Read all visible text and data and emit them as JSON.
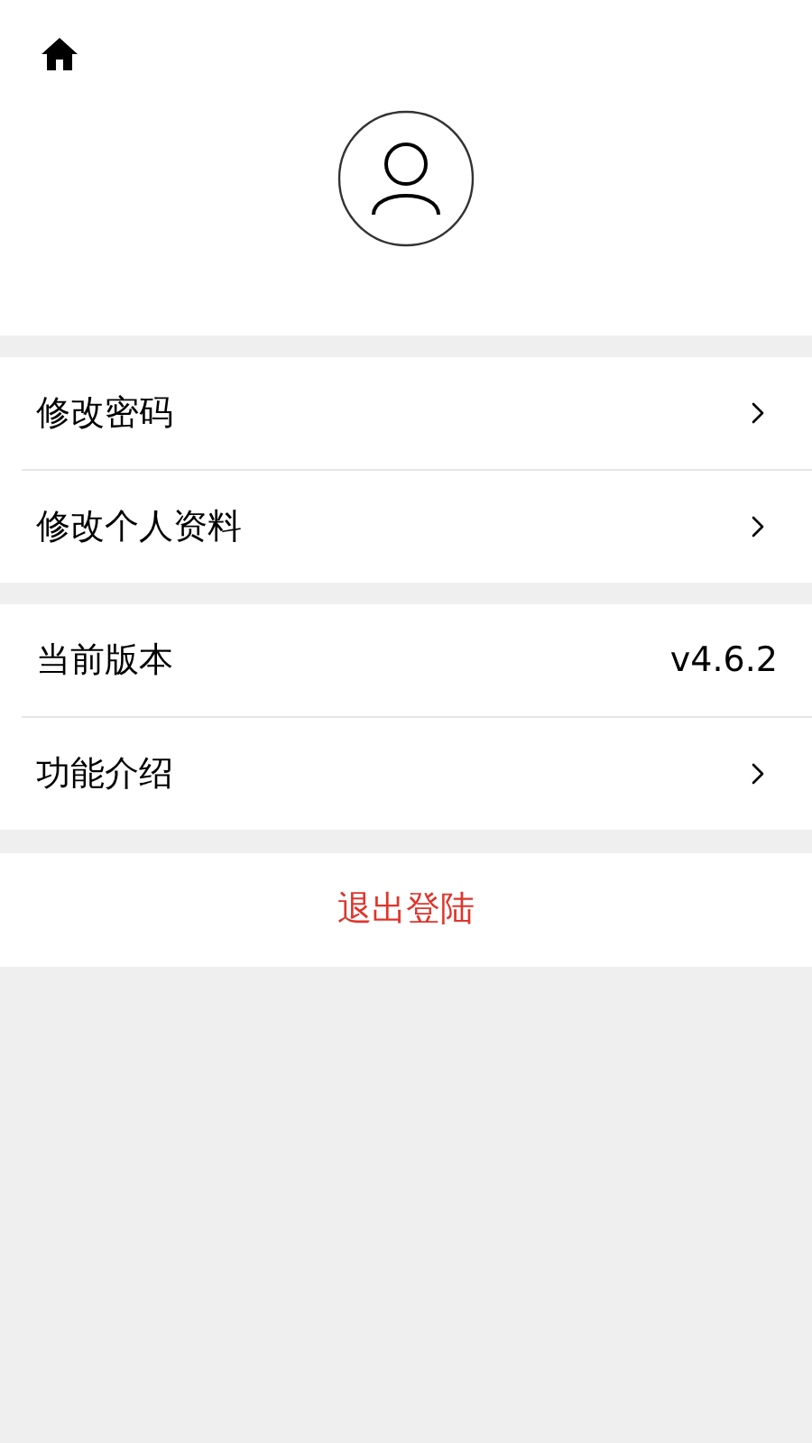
{
  "groups": [
    {
      "items": [
        {
          "kind": "link",
          "label": "修改密码"
        },
        {
          "kind": "link",
          "label": "修改个人资料"
        }
      ]
    },
    {
      "items": [
        {
          "kind": "value",
          "label": "当前版本",
          "value": "v4.6.2"
        },
        {
          "kind": "link",
          "label": "功能介绍"
        }
      ]
    }
  ],
  "logout": {
    "label": "退出登陆"
  }
}
